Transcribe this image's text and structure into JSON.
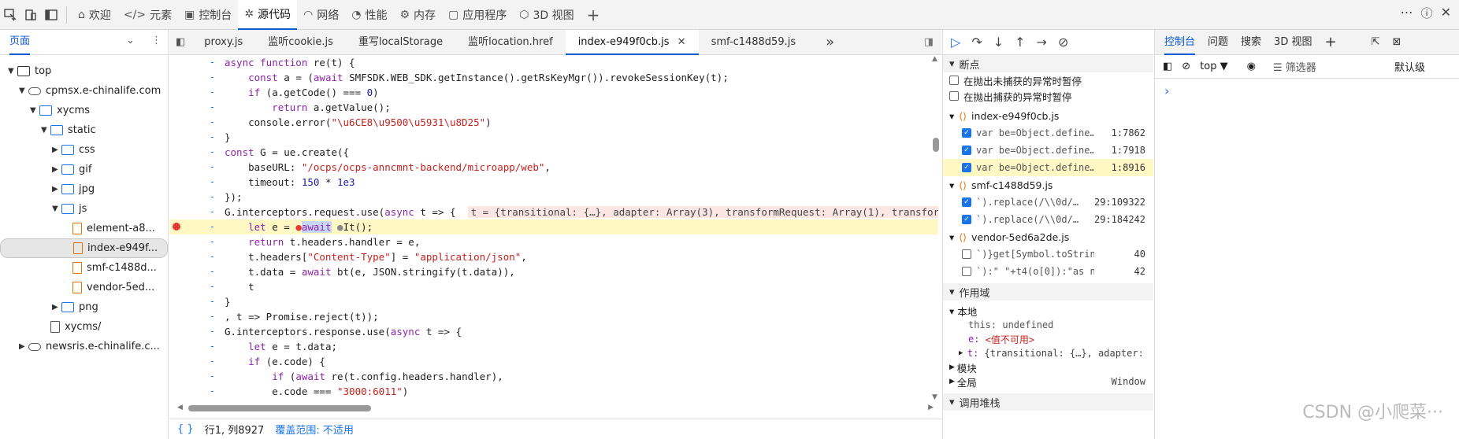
{
  "toolbar": {
    "tabs": [
      {
        "label": "欢迎",
        "icon": "home-icon"
      },
      {
        "label": "元素",
        "icon": "code-tag-icon"
      },
      {
        "label": "控制台",
        "icon": "terminal-icon"
      },
      {
        "label": "源代码",
        "icon": "bug-icon",
        "active": true
      },
      {
        "label": "网络",
        "icon": "wifi-icon"
      },
      {
        "label": "性能",
        "icon": "gauge-icon"
      },
      {
        "label": "内存",
        "icon": "memory-chip-icon"
      },
      {
        "label": "应用程序",
        "icon": "app-window-icon"
      },
      {
        "label": "3D 视图",
        "icon": "cube-icon"
      }
    ],
    "add_label": "+"
  },
  "left": {
    "tab": "页面",
    "tree": [
      {
        "label": "top",
        "depth": 0,
        "icon": "window",
        "open": true
      },
      {
        "label": "cpmsx.e-chinalife.com",
        "depth": 1,
        "icon": "cloud",
        "open": true
      },
      {
        "label": "xycms",
        "depth": 2,
        "icon": "folder",
        "open": true
      },
      {
        "label": "static",
        "depth": 3,
        "icon": "folder",
        "open": true
      },
      {
        "label": "css",
        "depth": 4,
        "icon": "folder",
        "open": false
      },
      {
        "label": "gif",
        "depth": 4,
        "icon": "folder",
        "open": false
      },
      {
        "label": "jpg",
        "depth": 4,
        "icon": "folder",
        "open": false
      },
      {
        "label": "js",
        "depth": 4,
        "icon": "folder",
        "open": true
      },
      {
        "label": "element-a8...",
        "depth": 5,
        "icon": "file"
      },
      {
        "label": "index-e949f...",
        "depth": 5,
        "icon": "file",
        "selected": true
      },
      {
        "label": "smf-c1488d...",
        "depth": 5,
        "icon": "file"
      },
      {
        "label": "vendor-5ed...",
        "depth": 5,
        "icon": "file"
      },
      {
        "label": "png",
        "depth": 4,
        "icon": "folder",
        "open": false
      },
      {
        "label": "xycms/",
        "depth": 3,
        "icon": "plainfile"
      },
      {
        "label": "newsris.e-chinalife.c...",
        "depth": 1,
        "icon": "cloud",
        "open": false
      }
    ]
  },
  "editor": {
    "tabs": [
      {
        "label": "proxy.js"
      },
      {
        "label": "监听cookie.js"
      },
      {
        "label": "重写localStorage"
      },
      {
        "label": "监听location.href"
      },
      {
        "label": "index-e949f0cb.js",
        "active": true,
        "closable": true
      },
      {
        "label": "smf-c1488d59.js"
      }
    ],
    "more": "»",
    "status": {
      "braces": "{ }",
      "position": "行1, 列8927",
      "coverage": "覆盖范围: 不适用"
    }
  },
  "debug": {
    "breakpoints_header": "断点",
    "pause_uncaught": "在抛出未捕获的异常时暂停",
    "pause_caught": "在抛出捕获的异常时暂停",
    "files": [
      {
        "name": "index-e949f0cb.js",
        "items": [
          {
            "code": "var be=Object.define…",
            "loc": "1:7862",
            "checked": true
          },
          {
            "code": "var be=Object.define…",
            "loc": "1:7918",
            "checked": true
          },
          {
            "code": "var be=Object.define…",
            "loc": "1:8916",
            "checked": true,
            "current": true
          }
        ]
      },
      {
        "name": "smf-c1488d59.js",
        "items": [
          {
            "code": "`).replace(/\\\\0d/…",
            "loc": "29:109322",
            "checked": true
          },
          {
            "code": "`).replace(/\\\\0d/…",
            "loc": "29:184242",
            "checked": true
          }
        ]
      },
      {
        "name": "vendor-5ed6a2de.js",
        "items": [
          {
            "code": "`)}get[Symbol.toStringT…",
            "loc": "40",
            "checked": false
          },
          {
            "code": "`):\" \"+t4(o[0]):\"as no …",
            "loc": "42",
            "checked": false
          }
        ]
      }
    ],
    "scope_header": "作用域",
    "local_label": "本地",
    "scope_this": "this: undefined",
    "scope_e_name": "e:",
    "scope_e_val": "<值不可用>",
    "scope_t_name": "t:",
    "scope_t_val": "{transitional: {…}, adapter:",
    "module_label": "模块",
    "global_label": "全局",
    "global_val": "Window",
    "callstack_header": "调用堆栈"
  },
  "console": {
    "tabs": [
      {
        "label": "控制台",
        "active": true
      },
      {
        "label": "问题"
      },
      {
        "label": "搜索"
      },
      {
        "label": "3D 视图"
      }
    ],
    "context": "top ▼",
    "filter": "筛选器",
    "level": "默认级",
    "prompt": "›"
  },
  "watermark": "CSDN @小爬菜···"
}
